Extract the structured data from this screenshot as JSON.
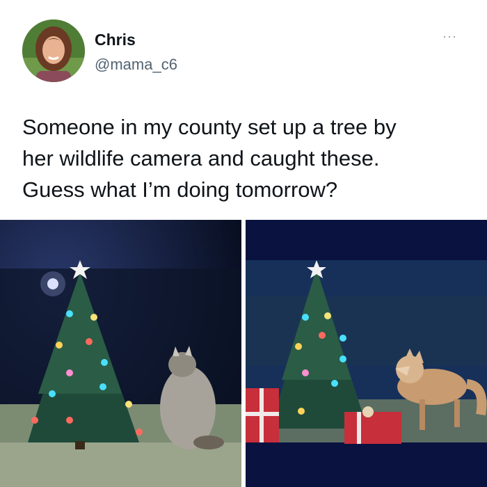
{
  "author": {
    "name": "Chris",
    "handle": "@mama_c6",
    "avatar_icon": "profile-photo-avatar"
  },
  "more_label": "···",
  "tweet": {
    "text_lines": [
      "Someone in my county set up a tree by",
      "her wildlife camera and caught these.",
      "Guess what I’m doing tomorrow?"
    ]
  },
  "media": [
    {
      "subject": "raccoon",
      "scene": "lit christmas tree at night"
    },
    {
      "subject": "fox",
      "scene": "lit christmas tree with presents at night"
    }
  ]
}
